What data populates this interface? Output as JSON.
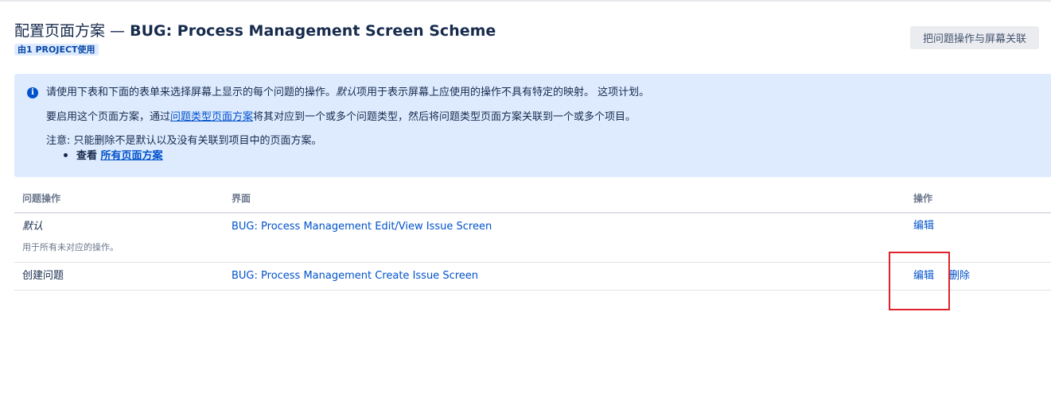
{
  "page": {
    "title_prefix": "配置页面方案 —",
    "title_scheme": "BUG: Process Management Screen Scheme",
    "usage_badge": "由1 PROJECT使用",
    "associate_button": "把问题操作与屏幕关联"
  },
  "info": {
    "line1_a": "请使用下表和下面的表单来选择屏幕上显示的每个问题的操作。",
    "line1_em": "默认",
    "line1_b": "项用于表示屏幕上应使用的操作不具有特定的映射。 这项计划。",
    "line2_a": "要启用这个页面方案，通过",
    "line2_link": "问题类型页面方案",
    "line2_b": "将其对应到一个或多个问题类型，然后将问题类型页面方案关联到一个或多个项目。",
    "line3": "注意: 只能删除不是默认以及没有关联到项目中的页面方案。",
    "bullet_label": "查看",
    "bullet_link": "所有页面方案"
  },
  "table": {
    "headers": [
      "问题操作",
      "界面",
      "操作"
    ],
    "rows": [
      {
        "operation": "默认",
        "operation_note": "用于所有未对应的操作。",
        "screen": "BUG: Process Management Edit/View Issue Screen",
        "edit": "编辑"
      },
      {
        "operation": "创建问题",
        "screen": "BUG: Process Management Create Issue Screen",
        "edit": "编辑",
        "delete": "删除"
      }
    ]
  },
  "colors": {
    "link": "#0052cc",
    "info_background": "#deebff",
    "highlight_box": "#e0222c"
  }
}
